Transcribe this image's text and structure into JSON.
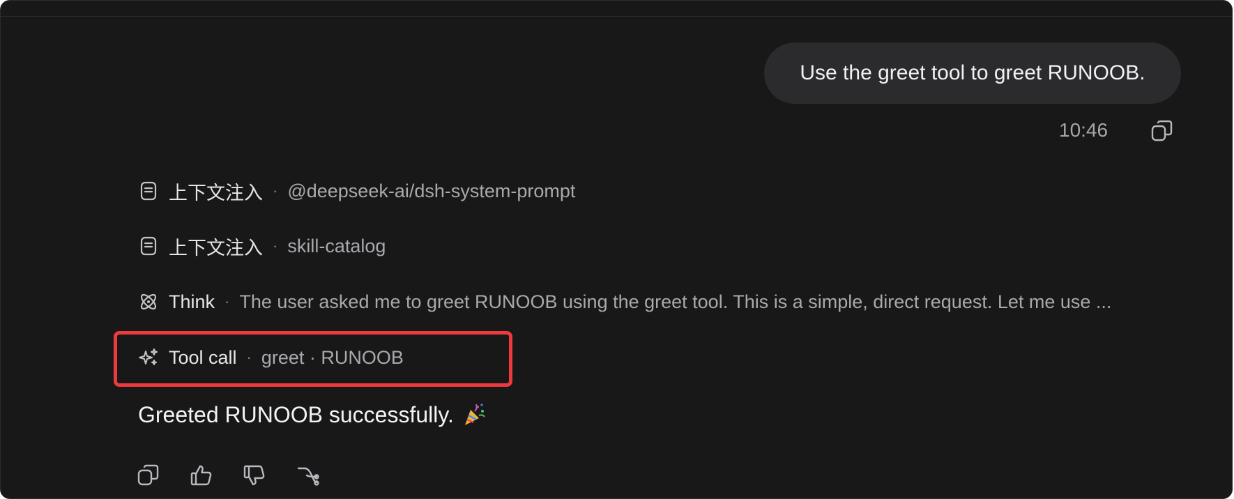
{
  "user_message": {
    "text": "Use the greet tool to greet RUNOOB.",
    "time": "10:46",
    "copy_icon": "copy-icon"
  },
  "steps": [
    {
      "icon": "document-icon",
      "label": "上下文注入",
      "separator": "·",
      "detail": "@deepseek-ai/dsh-system-prompt"
    },
    {
      "icon": "document-icon",
      "label": "上下文注入",
      "separator": "·",
      "detail": "skill-catalog"
    },
    {
      "icon": "atom-icon",
      "label": "Think",
      "separator": "·",
      "detail": "The user asked me to greet RUNOOB using the greet tool. This is a simple, direct request. Let me use ..."
    },
    {
      "icon": "sparkle-icon",
      "label": "Tool call",
      "separator": "·",
      "detail": "greet · RUNOOB"
    }
  ],
  "assistant_reply": {
    "text": "Greeted RUNOOB successfully.",
    "emoji_icon": "party-popper-icon"
  },
  "actions": [
    "copy-icon",
    "thumbs-up-icon",
    "thumbs-down-icon",
    "branch-icon"
  ],
  "colors": {
    "background": "#181819",
    "bubble": "#2b2b2e",
    "highlight_border": "#ee3a3f"
  }
}
